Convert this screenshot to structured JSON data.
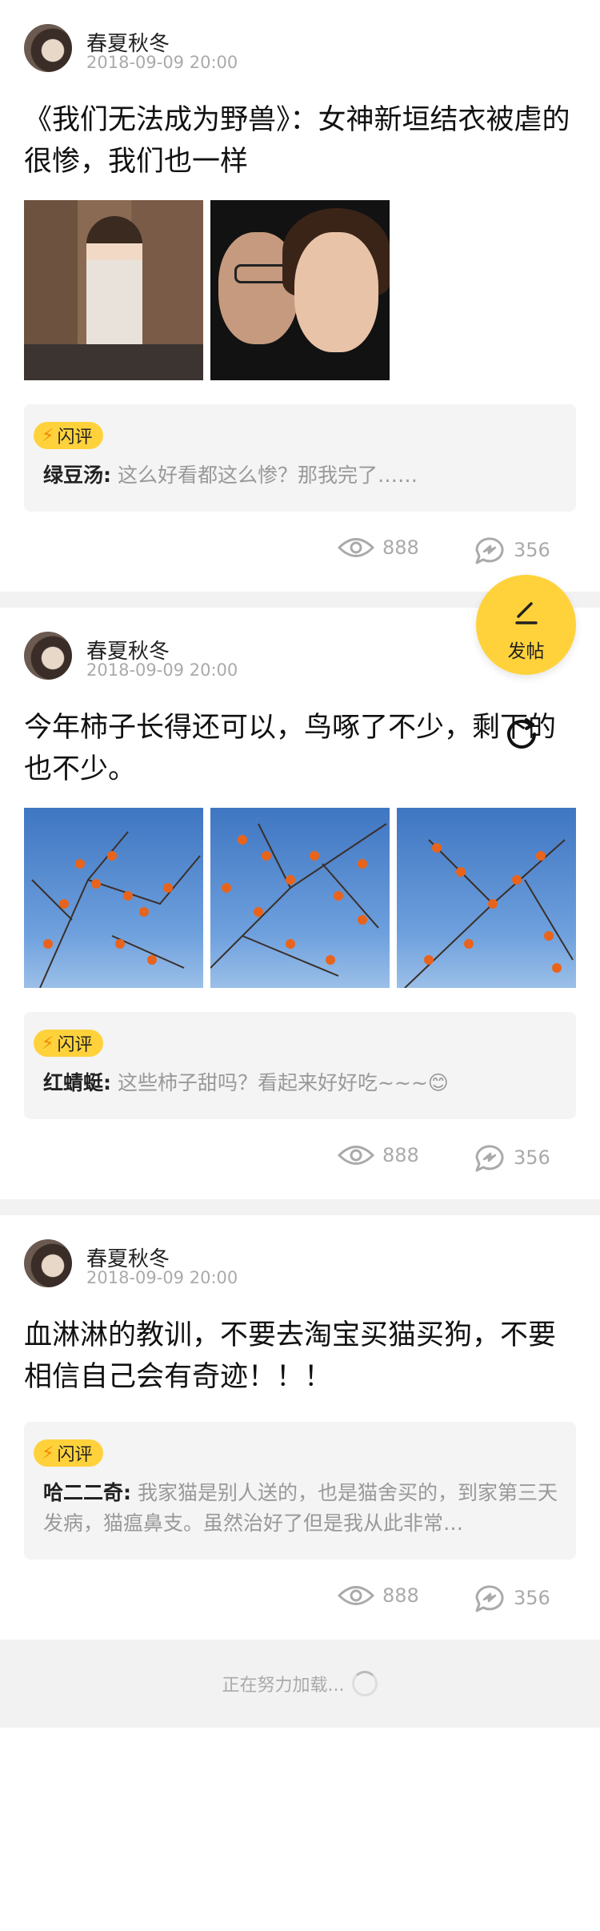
{
  "fab": {
    "label": "发帖",
    "icon": "pen-icon"
  },
  "refresh": {
    "icon": "refresh-icon"
  },
  "posts": [
    {
      "author": "春夏秋冬",
      "time": "2018-09-09 20:00",
      "title": "《我们无法成为野兽》：女神新垣结衣被虐的很惨，我们也一样",
      "badge": "闪评",
      "comment_author": "绿豆汤:",
      "comment_text": "这么好看都这么惨？那我完了……",
      "views": "888",
      "shares": "356"
    },
    {
      "author": "春夏秋冬",
      "time": "2018-09-09 20:00",
      "title": "今年柿子长得还可以，鸟啄了不少，剩下的也不少。",
      "badge": "闪评",
      "comment_author": "红蜻蜓:",
      "comment_text": "这些柿子甜吗？看起来好好吃~~~😊",
      "views": "888",
      "shares": "356"
    },
    {
      "author": "春夏秋冬",
      "time": "2018-09-09 20:00",
      "title": "血淋淋的教训，不要去淘宝买猫买狗，不要相信自己会有奇迹！！！",
      "badge": "闪评",
      "comment_author": "哈二二奇:",
      "comment_text": "我家猫是别人送的，也是猫舍买的，到家第三天发病，猫瘟鼻支。虽然治好了但是我从此非常…",
      "views": "888",
      "shares": "356"
    }
  ],
  "loading": {
    "text": "正在努力加载..."
  },
  "colors": {
    "accent": "#ffd23c",
    "badge_bolt": "#f08a00"
  }
}
